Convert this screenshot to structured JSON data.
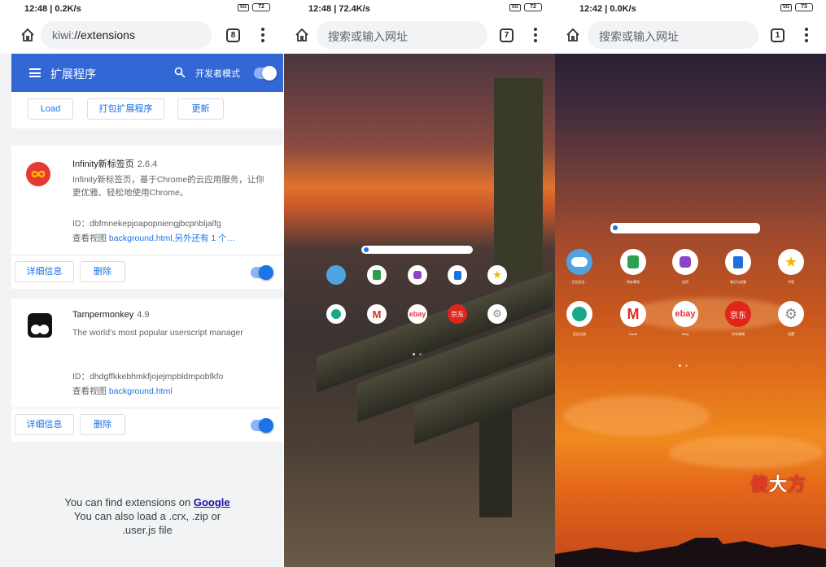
{
  "panel1": {
    "status": {
      "time": "12:48 | 0.2K/s",
      "battery": "72"
    },
    "url": {
      "prefix": "kiwi:",
      "rest": "//extensions"
    },
    "tab_count": "8",
    "header": {
      "title": "扩展程序",
      "dev_mode_label": "开发者模式"
    },
    "buttons": {
      "load": "Load",
      "pack": "打包扩展程序",
      "update": "更新"
    },
    "extensions": [
      {
        "name": "Infinity新标签页",
        "version": "2.6.4",
        "description": "Infinity新标签页，基于Chrome的云应用服务，让你更优雅、轻松地使用Chrome。",
        "id_line": "ID：dbfmnekepjoapopniengjbcpnbljalfg",
        "view_prefix": "查看视图 ",
        "view_link": "background.html,另外还有 1 个…",
        "details": "详细信息",
        "remove": "删除",
        "logo_color": "#e53935"
      },
      {
        "name": "Tampermonkey",
        "version": "4.9",
        "description": "The world's most popular userscript manager",
        "id_line": "ID：dhdgffkkebhmkfjojejmpbldmpobfkfo",
        "view_prefix": "查看视图 ",
        "view_link": "background.html",
        "details": "详细信息",
        "remove": "删除",
        "logo_color": "#111111"
      }
    ],
    "footer": {
      "line1_prefix": "You can find extensions on ",
      "line1_link": "Google",
      "line2": "You can also load a .crx, .zip or",
      "line3": ".user.js file"
    }
  },
  "panel2": {
    "status": {
      "time": "12:48 | 72.4K/s",
      "battery": "72"
    },
    "search_placeholder": "搜索或输入网址",
    "tab_count": "7"
  },
  "panel3": {
    "status": {
      "time": "12:42 | 0.0K/s",
      "battery": "73"
    },
    "search_placeholder": "搜索或输入网址",
    "tab_count": "1",
    "apps_row1": [
      {
        "label": "正在定位...",
        "icon": "weather-icon",
        "color": "#4fa3e0"
      },
      {
        "label": "待办事项",
        "icon": "note-icon",
        "color": "#2e9e4f"
      },
      {
        "label": "应用",
        "icon": "apps-icon",
        "color": "#8e44c9"
      },
      {
        "label": "笔记与创意",
        "icon": "notebook-icon",
        "color": "#1e6fe0"
      },
      {
        "label": "书签",
        "icon": "star-icon",
        "color": "#f2b705"
      }
    ],
    "apps_row2": [
      {
        "label": "历史记录",
        "icon": "clock-icon",
        "color": "#1aa88a"
      },
      {
        "label": "Gmail",
        "icon": "gmail-icon",
        "color": "#ffffff"
      },
      {
        "label": "eBay",
        "icon": "ebay-icon",
        "color": "#ffffff"
      },
      {
        "label": "京东商城",
        "icon": "jd-icon",
        "color": "#e1251b"
      },
      {
        "label": "设置",
        "icon": "settings-icon",
        "color": "#ffffff"
      }
    ],
    "ebay_text": "ebay",
    "jd_text": "京东",
    "watermark": {
      "a": "傻",
      "b": "大",
      "c": "方"
    }
  }
}
